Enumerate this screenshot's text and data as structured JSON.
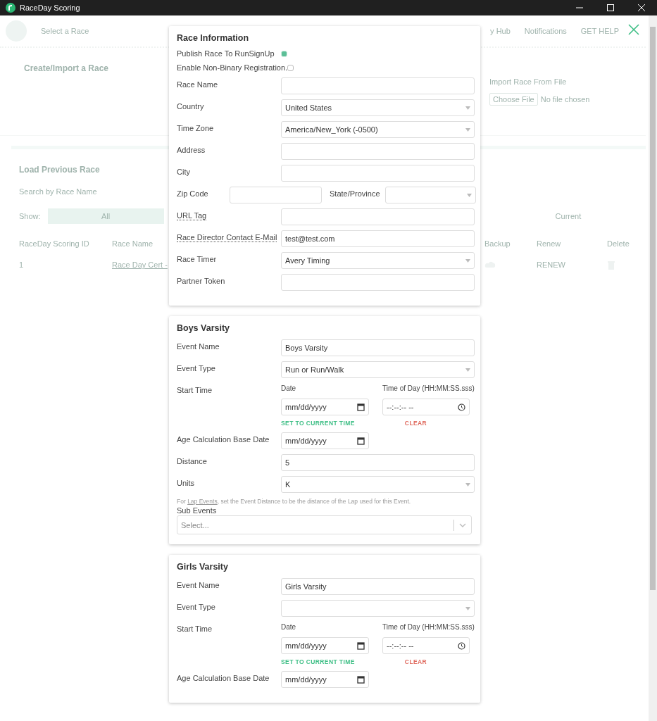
{
  "window": {
    "title": "RaceDay Scoring"
  },
  "background": {
    "nav": {
      "race_select": "Select a Race",
      "hub": "y Hub",
      "notifications": "Notifications",
      "help": "GET HELP"
    },
    "create_title": "Create/Import a Race",
    "import_title": "Import Race From File",
    "choose_file": "Choose File",
    "no_file": "No file chosen",
    "load_title": "Load Previous Race",
    "search_placeholder": "Search by Race Name",
    "show_label": "Show:",
    "filters": [
      {
        "label": "All",
        "selected": true
      },
      {
        "label": "Current",
        "selected": false
      }
    ],
    "columns": [
      "RaceDay Scoring ID",
      "Race Name",
      "Backup",
      "Renew",
      "Delete"
    ],
    "rows": [
      {
        "id": "1",
        "name": "Race Day Cert - ",
        "renew": "RENEW"
      }
    ]
  },
  "race_info": {
    "title": "Race Information",
    "checkboxes": [
      {
        "label": "Publish Race To RunSignUp",
        "checked": true
      },
      {
        "label": "Enable Non-Binary Registration.",
        "checked": false
      }
    ],
    "fields": [
      {
        "kind": "text",
        "label": "Race Name"
      },
      {
        "kind": "select",
        "label": "Country",
        "value": "United States"
      },
      {
        "kind": "select",
        "label": "Time Zone",
        "value": "America/New_York (-0500)"
      },
      {
        "kind": "text",
        "label": "Address"
      },
      {
        "kind": "text",
        "label": "City"
      },
      {
        "kind": "zip",
        "label": "Zip Code",
        "second_label": "State/Province"
      },
      {
        "kind": "text",
        "label": "URL Tag",
        "tooltip": true
      },
      {
        "kind": "text",
        "label": "Race Director Contact E-Mail",
        "value": "test@test.com",
        "tooltip": true
      },
      {
        "kind": "select",
        "label": "Race Timer",
        "value": "Avery Timing"
      },
      {
        "kind": "text",
        "label": "Partner Token"
      }
    ]
  },
  "events": [
    {
      "title": "Boys Varsity",
      "fields": [
        {
          "kind": "text",
          "label": "Event Name",
          "value": "Boys Varsity"
        },
        {
          "kind": "select",
          "label": "Event Type",
          "value": "Run or Run/Walk"
        },
        {
          "kind": "start",
          "label": "Start Time",
          "date_label": "Date",
          "time_label": "Time of Day (HH:MM:SS.sss)",
          "date_placeholder": "mm/dd/yyyy",
          "time_placeholder": "--:--:-- --",
          "set_now": "SET TO CURRENT TIME",
          "clear": "CLEAR"
        },
        {
          "kind": "date",
          "label": "Age Calculation Base Date",
          "placeholder": "mm/dd/yyyy"
        },
        {
          "kind": "text",
          "label": "Distance",
          "value": "5"
        },
        {
          "kind": "select",
          "label": "Units",
          "value": "K"
        },
        {
          "kind": "note",
          "before": "For ",
          "link": "Lap Events",
          "after": ", set the Event Distance to be the distance of the Lap used for this Event."
        },
        {
          "kind": "multi",
          "label": "Sub Events",
          "placeholder": "Select..."
        }
      ]
    },
    {
      "title": "Girls Varsity",
      "fields": [
        {
          "kind": "text",
          "label": "Event Name",
          "value": "Girls Varsity"
        },
        {
          "kind": "select",
          "label": "Event Type"
        },
        {
          "kind": "start",
          "label": "Start Time",
          "date_label": "Date",
          "time_label": "Time of Day (HH:MM:SS.sss)",
          "date_placeholder": "mm/dd/yyyy",
          "time_placeholder": "--:--:-- --",
          "set_now": "SET TO CURRENT TIME",
          "clear": "CLEAR"
        },
        {
          "kind": "date",
          "label": "Age Calculation Base Date",
          "placeholder": "mm/dd/yyyy"
        }
      ]
    }
  ]
}
